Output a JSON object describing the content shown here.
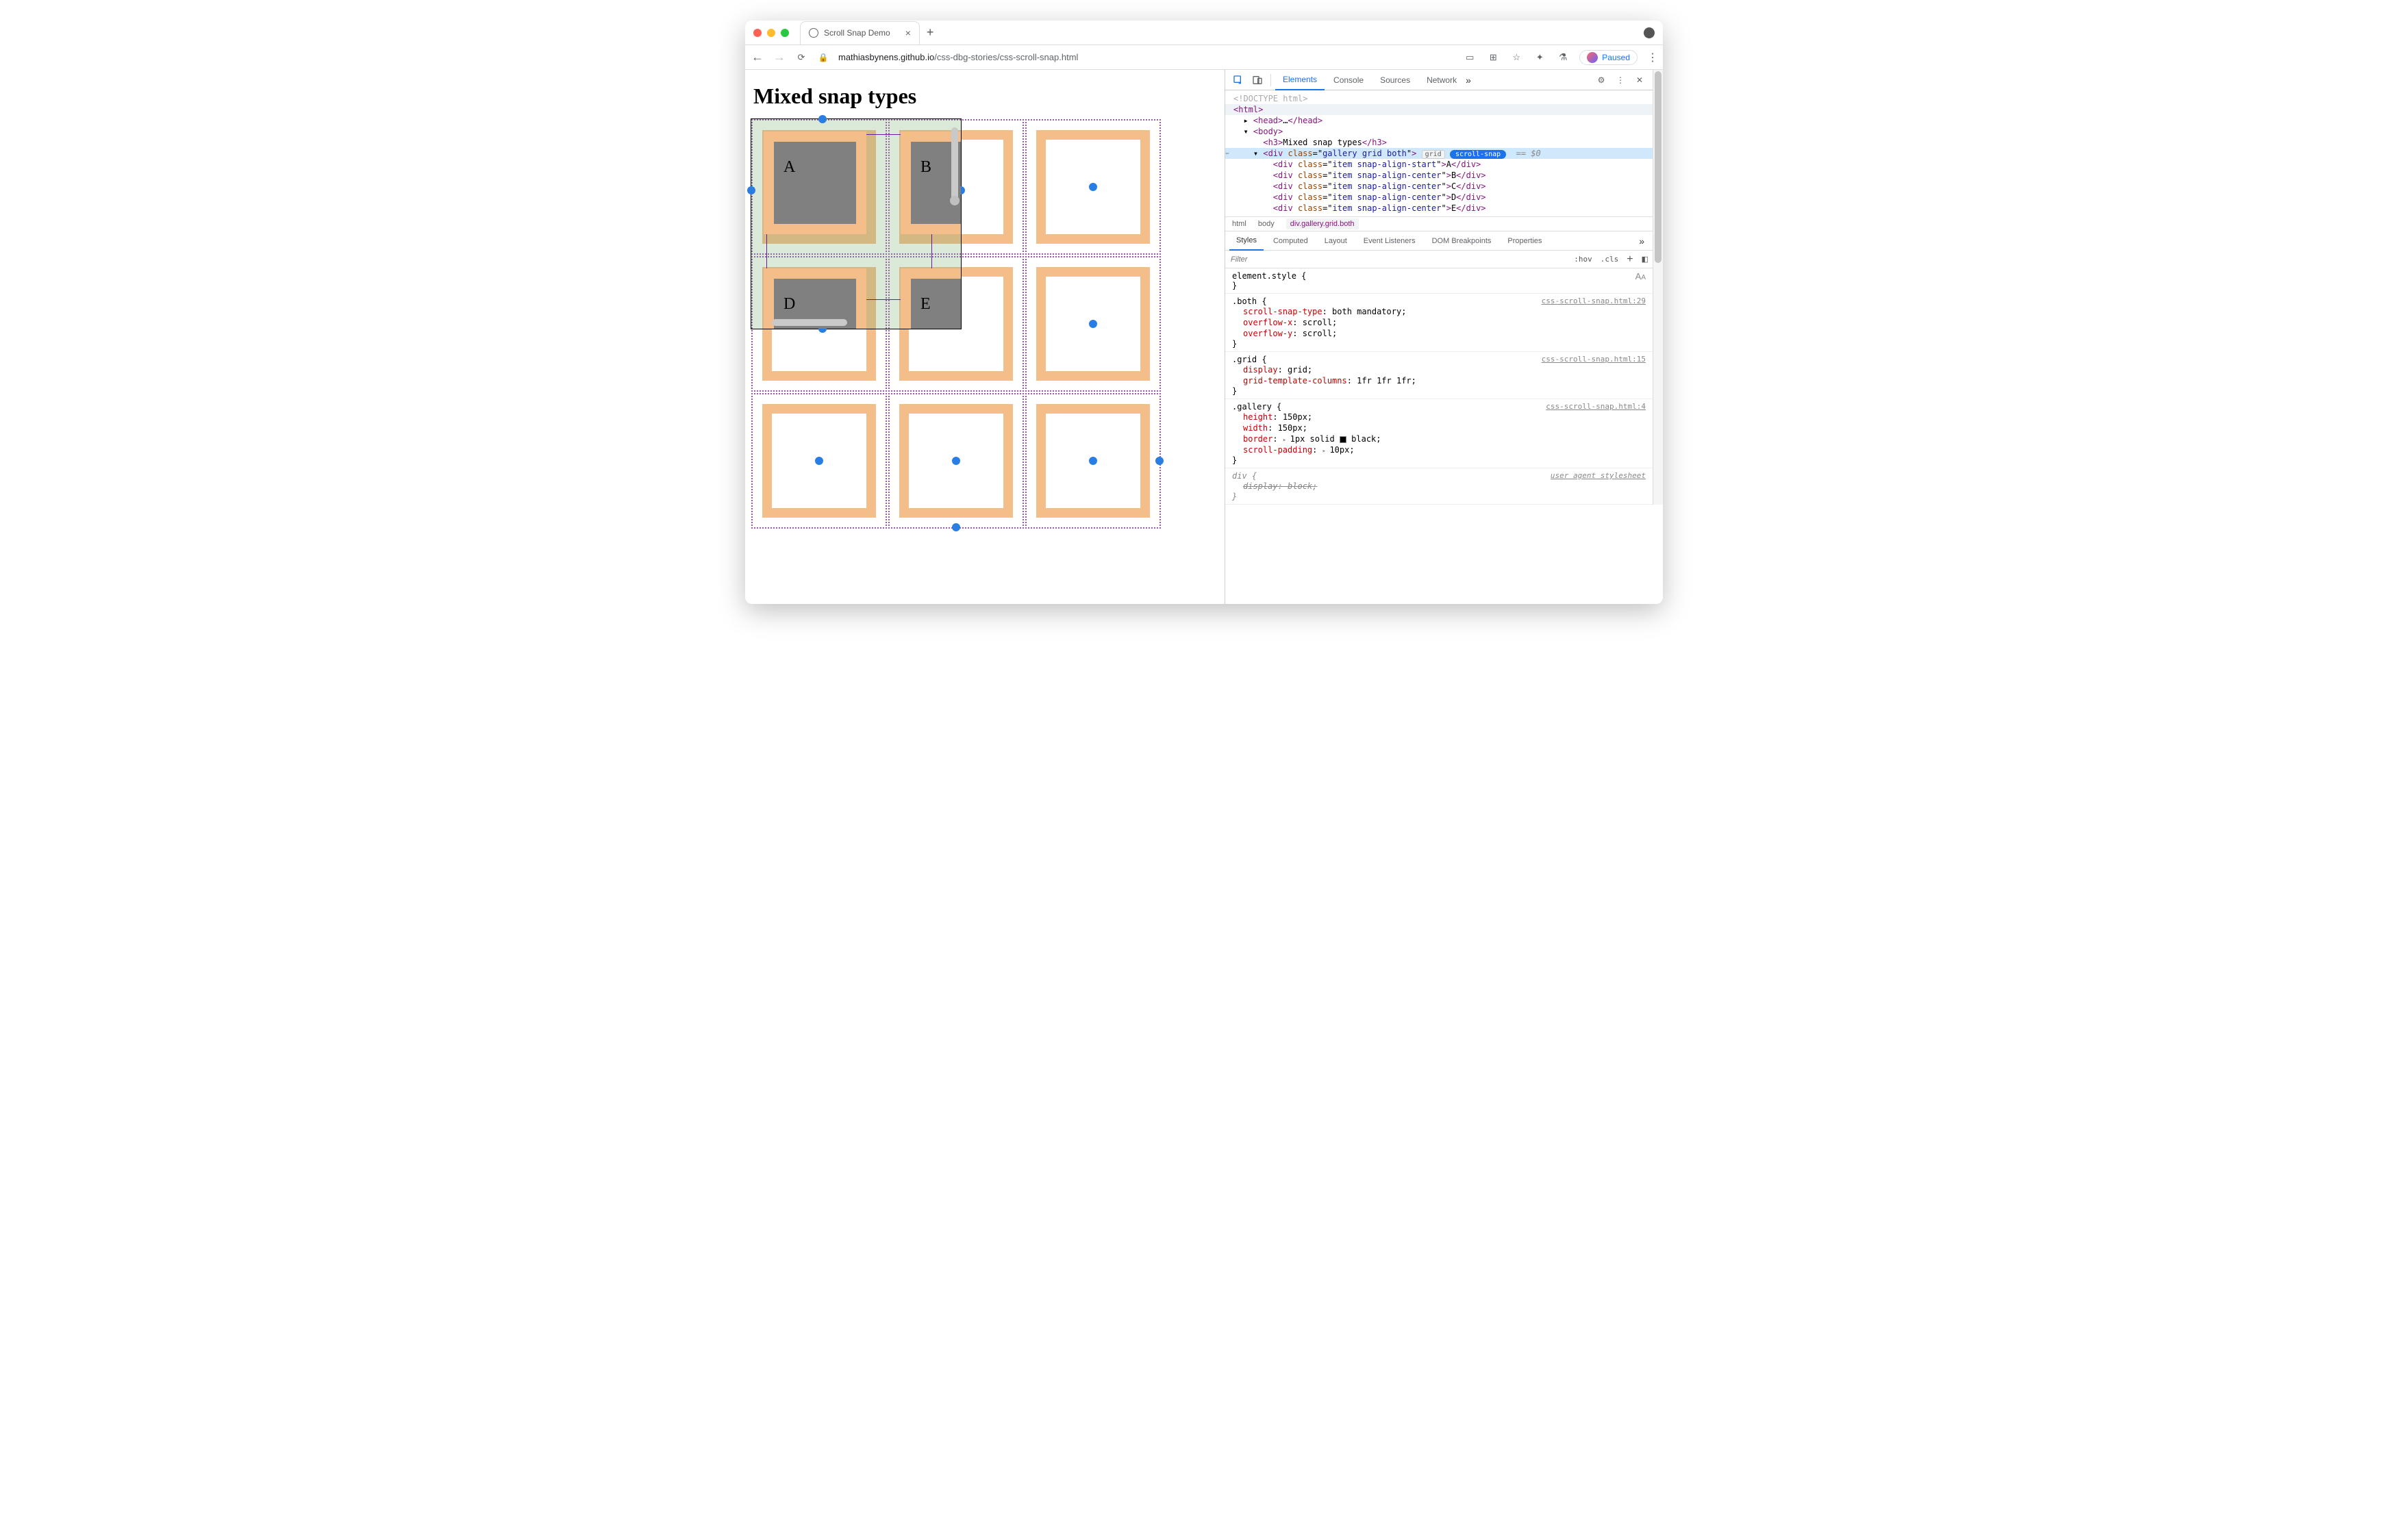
{
  "browser": {
    "tab_title": "Scroll Snap Demo",
    "url_host": "mathiasbynens.github.io",
    "url_path": "/css-dbg-stories/css-scroll-snap.html",
    "paused_label": "Paused"
  },
  "page": {
    "heading": "Mixed snap types",
    "cells": {
      "A": "A",
      "B": "B",
      "D": "D",
      "E": "E"
    }
  },
  "devtools": {
    "tabs": {
      "elements": "Elements",
      "console": "Console",
      "sources": "Sources",
      "network": "Network"
    },
    "elements": {
      "doctype": "<!DOCTYPE html>",
      "html_open": "<html>",
      "head": "<head>…</head>",
      "body_open": "<body>",
      "h3_text": "Mixed snap types",
      "sel_class": "gallery grid both",
      "sel_badge_grid": "grid",
      "sel_badge_snap": "scroll-snap",
      "sel_eq": " == ",
      "sel_zero": "$0",
      "items": [
        {
          "class": "item snap-align-start",
          "text": "A"
        },
        {
          "class": "item snap-align-center",
          "text": "B"
        },
        {
          "class": "item snap-align-center",
          "text": "C"
        },
        {
          "class": "item snap-align-center",
          "text": "D"
        },
        {
          "class": "item snap-align-center",
          "text": "E"
        }
      ]
    },
    "crumbs": {
      "html": "html",
      "body": "body",
      "cur": "div.gallery.grid.both"
    },
    "style_tabs": {
      "styles": "Styles",
      "computed": "Computed",
      "layout": "Layout",
      "event": "Event Listeners",
      "dom": "DOM Breakpoints",
      "props": "Properties"
    },
    "filter": {
      "placeholder": "Filter",
      "hov": ":hov",
      "cls": ".cls"
    },
    "styles": {
      "element_style": "element.style {",
      "close": "}",
      "both": {
        "selector": ".both {",
        "src": "css-scroll-snap.html:29",
        "rules": [
          {
            "prop": "scroll-snap-type",
            "val": "both mandatory;"
          },
          {
            "prop": "overflow-x",
            "val": "scroll;"
          },
          {
            "prop": "overflow-y",
            "val": "scroll;"
          }
        ]
      },
      "grid": {
        "selector": ".grid {",
        "src": "css-scroll-snap.html:15",
        "rules": [
          {
            "prop": "display",
            "val": "grid;"
          },
          {
            "prop": "grid-template-columns",
            "val": "1fr 1fr 1fr;"
          }
        ]
      },
      "gallery": {
        "selector": ".gallery {",
        "src": "css-scroll-snap.html:4",
        "rules": [
          {
            "prop": "height",
            "val": "150px;"
          },
          {
            "prop": "width",
            "val": "150px;"
          },
          {
            "prop": "border",
            "val": "1px solid ",
            "swatch": true,
            "after": "black;"
          },
          {
            "prop": "scroll-padding",
            "val": "10px;"
          }
        ]
      },
      "div": {
        "selector": "div {",
        "src": "user agent stylesheet",
        "strike_prop": "display",
        "strike_val": "block;"
      }
    }
  }
}
